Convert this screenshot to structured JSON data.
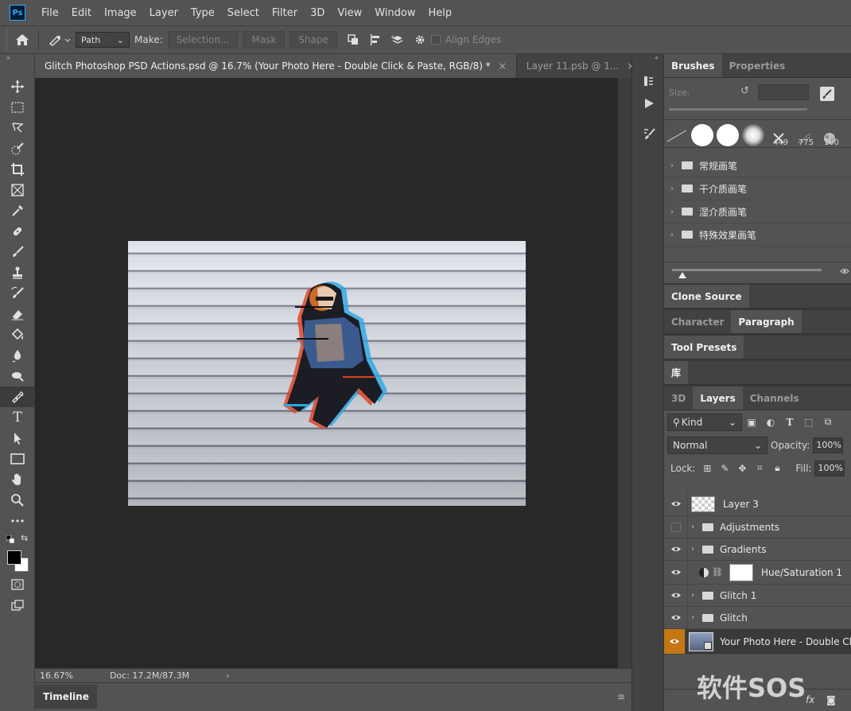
{
  "app": {
    "logo": "Ps"
  },
  "menu": [
    "File",
    "Edit",
    "Image",
    "Layer",
    "Type",
    "Select",
    "Filter",
    "3D",
    "View",
    "Window",
    "Help"
  ],
  "options": {
    "mode_value": "Path",
    "make_label": "Make:",
    "selection_btn": "Selection...",
    "mask_btn": "Mask",
    "shape_btn": "Shape",
    "align_edges": "Align Edges"
  },
  "tabs": [
    {
      "label": "Glitch Photoshop PSD Actions.psd @ 16.7% (Your Photo Here - Double Click & Paste, RGB/8) *",
      "close": "×"
    },
    {
      "label": "Layer 11.psb @ 1...",
      "close": "×"
    }
  ],
  "status": {
    "zoom": "16.67%",
    "doc": "Doc: 17.2M/87.3M",
    "arrow": "›"
  },
  "timeline": {
    "label": "Timeline",
    "menu": "≡"
  },
  "brushes": {
    "tabs": [
      "Brushes",
      "Properties"
    ],
    "size_label": "Size:",
    "preset_counts": [
      "449",
      "775",
      "100"
    ],
    "folders": [
      "常规画笔",
      "干介质画笔",
      "湿介质画笔",
      "特殊效果画笔"
    ]
  },
  "panel_tabs": {
    "clone_source": "Clone Source",
    "character": "Character",
    "paragraph": "Paragraph",
    "tool_presets": "Tool Presets",
    "library": "库",
    "three_d": "3D",
    "layers": "Layers",
    "channels": "Channels"
  },
  "layers": {
    "filter_kind": "Kind",
    "blend_mode": "Normal",
    "opacity_label": "Opacity:",
    "opacity_value": "100%",
    "lock_label": "Lock:",
    "fill_label": "Fill:",
    "fill_value": "100%",
    "items": [
      {
        "name": "Layer 3",
        "type": "pixel",
        "visible": true
      },
      {
        "name": "Adjustments",
        "type": "group",
        "visible": false
      },
      {
        "name": "Gradients",
        "type": "group",
        "visible": true
      },
      {
        "name": "Hue/Saturation 1",
        "type": "adjustment",
        "visible": true
      },
      {
        "name": "Glitch 1",
        "type": "group",
        "visible": true
      },
      {
        "name": "Glitch",
        "type": "group",
        "visible": true
      },
      {
        "name": "Your Photo Here - Double Click",
        "type": "smart",
        "visible": true,
        "selected": true
      }
    ],
    "footer_fx": "fx"
  },
  "watermark": "软件SOS",
  "colors": {
    "accent": "#c47614",
    "panel": "#535353",
    "dark": "#424242",
    "canvas": "#282828"
  }
}
